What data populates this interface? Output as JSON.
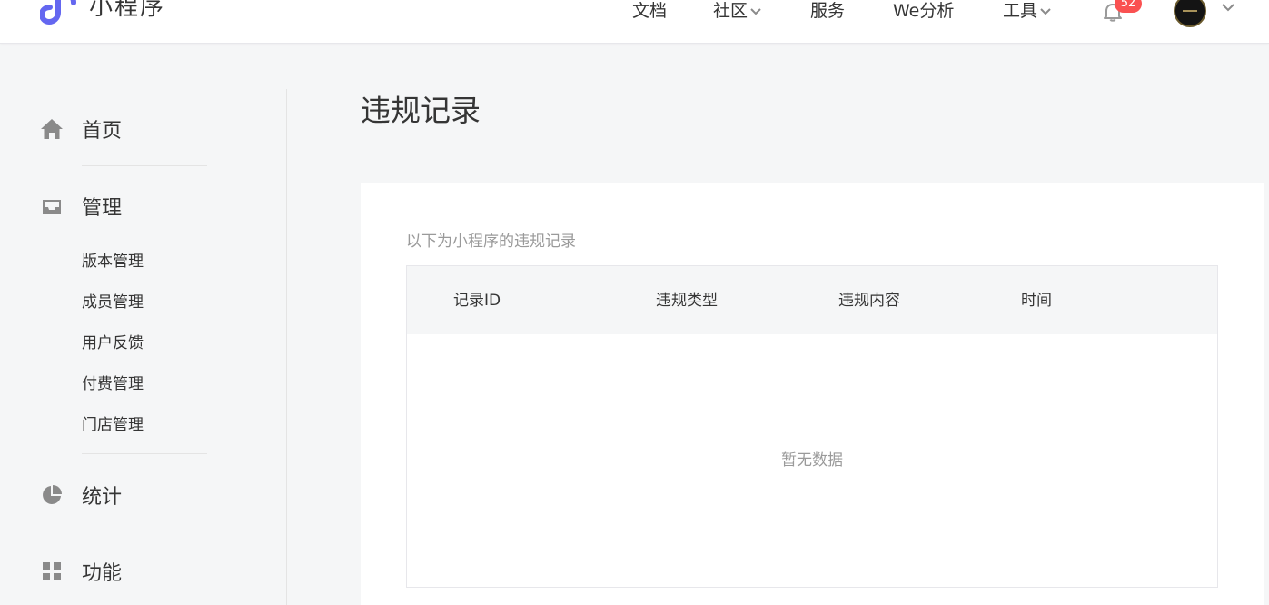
{
  "header": {
    "app_name": "小程序",
    "nav": [
      {
        "label": "文档",
        "has_dropdown": false
      },
      {
        "label": "社区",
        "has_dropdown": true
      },
      {
        "label": "服务",
        "has_dropdown": false
      },
      {
        "label": "We分析",
        "has_dropdown": false
      },
      {
        "label": "工具",
        "has_dropdown": true
      }
    ],
    "notification_count": "52",
    "bell_icon": "bell-icon",
    "avatar_icon": "user-avatar"
  },
  "sidebar": {
    "sections": [
      {
        "label": "首页",
        "icon": "home-icon"
      },
      {
        "label": "管理",
        "icon": "inbox-icon",
        "items": [
          "版本管理",
          "成员管理",
          "用户反馈",
          "付费管理",
          "门店管理"
        ]
      },
      {
        "label": "统计",
        "icon": "pie-chart-icon"
      },
      {
        "label": "功能",
        "icon": "grid-icon"
      }
    ]
  },
  "main": {
    "title": "违规记录",
    "description": "以下为小程序的违规记录",
    "table": {
      "columns": [
        "记录ID",
        "违规类型",
        "违规内容",
        "时间"
      ],
      "rows": [],
      "empty_text": "暂无数据"
    }
  },
  "colors": {
    "brand": "#6467f0",
    "badge": "#fa5151",
    "icon_gray": "#8a8a8a",
    "background": "#f5f6f7"
  }
}
